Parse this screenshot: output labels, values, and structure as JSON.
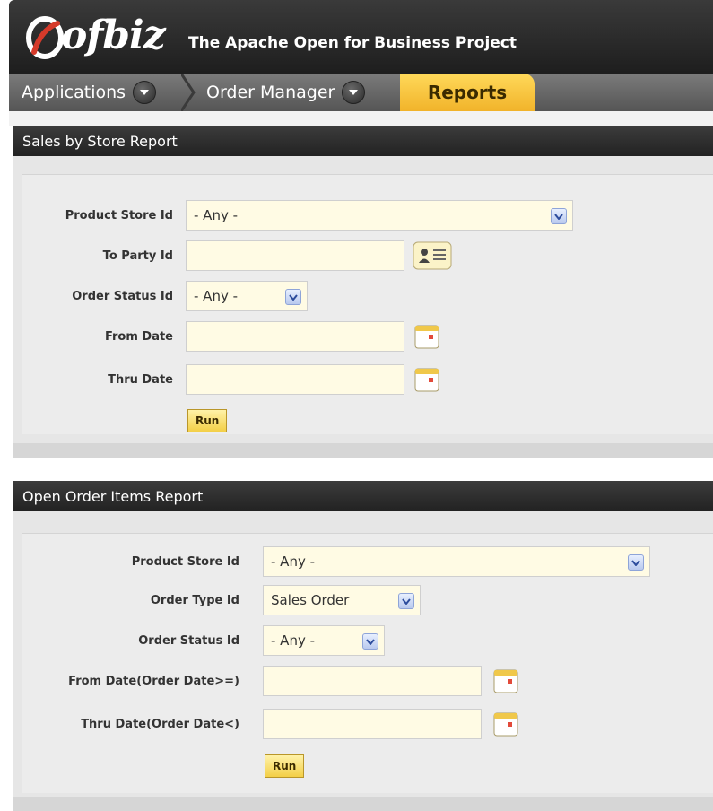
{
  "app": {
    "logo": "ofbiz",
    "tagline": "The Apache Open for Business Project"
  },
  "tabs": [
    {
      "label": "Applications"
    },
    {
      "label": "Order Manager"
    },
    {
      "label": "Reports"
    }
  ],
  "sales_report": {
    "title": "Sales by Store Report",
    "fields": {
      "product_store": {
        "label": "Product Store Id",
        "value": "- Any -"
      },
      "to_party": {
        "label": "To Party Id",
        "value": ""
      },
      "order_status": {
        "label": "Order Status Id",
        "value": "- Any -"
      },
      "from_date": {
        "label": "From Date",
        "value": ""
      },
      "thru_date": {
        "label": "Thru Date",
        "value": ""
      }
    },
    "run_label": "Run"
  },
  "open_items_report": {
    "title": "Open Order Items Report",
    "fields": {
      "product_store": {
        "label": "Product Store Id",
        "value": "- Any -"
      },
      "order_type": {
        "label": "Order Type Id",
        "value": "Sales Order"
      },
      "order_status": {
        "label": "Order Status Id",
        "value": "- Any -"
      },
      "from_date": {
        "label": "From Date(Order Date>=)",
        "value": ""
      },
      "thru_date": {
        "label": "Thru Date(Order Date<)",
        "value": ""
      }
    },
    "run_label": "Run"
  },
  "colors": {
    "tab_active": "#f7c23a",
    "field_bg": "#fffbe4",
    "panel_title_bg": "#2b2b2b"
  },
  "icons": [
    "ofbiz-logo-icon",
    "chevron-down-icon",
    "calendar-icon",
    "party-lookup-icon"
  ]
}
